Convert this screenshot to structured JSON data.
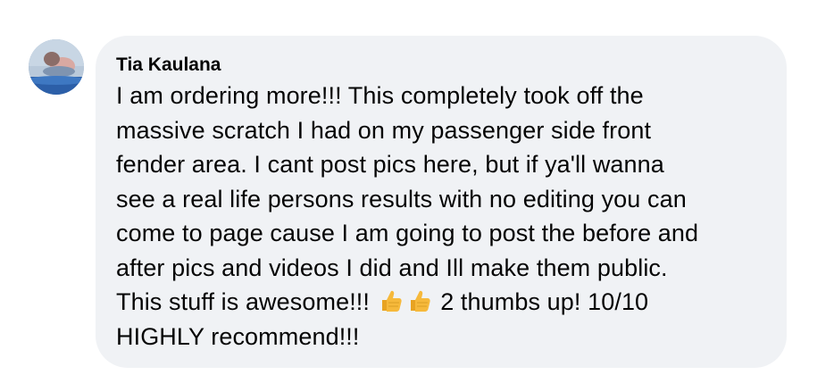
{
  "comment": {
    "author": "Tia Kaulana",
    "text_lines": [
      "I am ordering more!!! This completely took off the",
      "massive scratch I had on my passenger side front",
      "fender area. I cant post pics here, but if ya'll wanna",
      "see a real life persons results with no editing you can",
      "come to page cause I am going to post the before and",
      "after pics and videos I did and Ill make them public.",
      "This stuff is awesome!!! ",
      "HIGHLY recommend!!!"
    ],
    "line7_after_emoji": " 2 thumbs up! 10/10",
    "emojis": [
      "thumbs-up-icon",
      "thumbs-up-icon"
    ]
  },
  "colors": {
    "bubble_background": "#f0f2f5",
    "text": "#050505",
    "emoji": "#f6b93b"
  }
}
